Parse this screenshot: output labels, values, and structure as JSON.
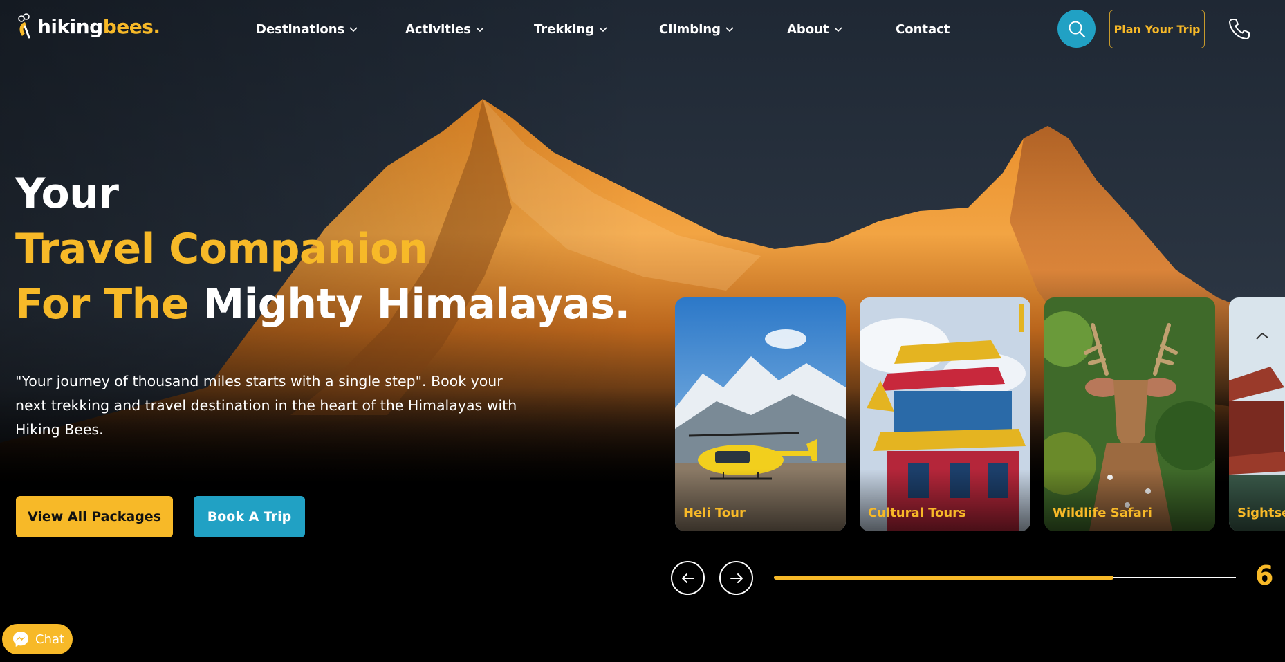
{
  "brand": {
    "name_part1": "hiking",
    "name_part2": "bees."
  },
  "nav": {
    "items": [
      {
        "label": "Destinations",
        "has_dropdown": true
      },
      {
        "label": "Activities",
        "has_dropdown": true
      },
      {
        "label": "Trekking",
        "has_dropdown": true
      },
      {
        "label": "Climbing",
        "has_dropdown": true
      },
      {
        "label": "About",
        "has_dropdown": true
      },
      {
        "label": "Contact",
        "has_dropdown": false
      }
    ]
  },
  "header_actions": {
    "search_icon": "search-icon",
    "plan_trip_label": "Plan Your Trip",
    "phone_icon": "phone-icon"
  },
  "hero": {
    "line1": "Your",
    "line2": "Travel Companion",
    "line3_gold": "For The",
    "line3_white": "Mighty Himalayas.",
    "subtitle": "\"Your journey of thousand miles starts with a single step\". Book your next trekking and travel destination in the heart of the Himalayas with Hiking Bees.",
    "primary_button": "View All Packages",
    "secondary_button": "Book A Trip"
  },
  "activities": {
    "cards": [
      {
        "label": "Heli Tour"
      },
      {
        "label": "Cultural Tours"
      },
      {
        "label": "Wildlife Safari"
      },
      {
        "label": "Sightseeing"
      }
    ],
    "slider": {
      "prev_icon": "arrow-left-icon",
      "next_icon": "arrow-right-icon",
      "progress_fraction": 0.735,
      "count": "6"
    }
  },
  "chat": {
    "label": "Chat",
    "icon": "messenger-icon"
  },
  "colors": {
    "accent_gold": "#f7b928",
    "accent_teal": "#21a1c4",
    "background": "#000000"
  }
}
